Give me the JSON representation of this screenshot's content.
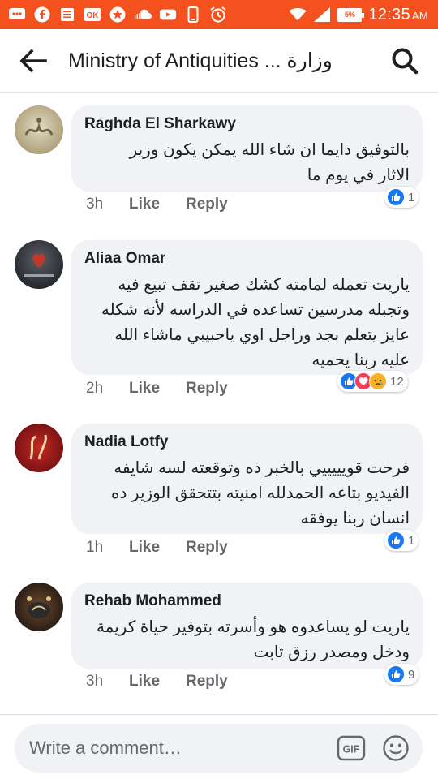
{
  "status_bar": {
    "time": "12:35",
    "ampm": "AM",
    "battery": "5%",
    "colors": {
      "background": "#f4511e"
    },
    "icons": [
      "messages-icon",
      "facebook-icon",
      "news-icon",
      "vk-icon",
      "star-icon",
      "soundcloud-icon",
      "youtube-icon",
      "phone-icon",
      "alarm-icon",
      "wifi-icon",
      "signal-icon",
      "battery-icon"
    ]
  },
  "header": {
    "title": "Ministry of Antiquities ... وزارة"
  },
  "comments": [
    {
      "author": "Raghda El Sharkawy",
      "text": "بالتوفيق دايما ان شاء الله يمكن يكون وزير الاثار في يوم ما",
      "time": "3h",
      "like": "Like",
      "reply": "Reply",
      "reactions": [
        "like"
      ],
      "reaction_count": "1"
    },
    {
      "author": "Aliaa Omar",
      "text": "ياريت تعمله لمامته كشك صغير تقف تبيع فيه وتجبله مدرسين تساعده في الدراسه لأنه شكله عايز يتعلم بجد وراجل اوي ياحبيبي ماشاء الله عليه ربنا يحميه",
      "time": "2h",
      "like": "Like",
      "reply": "Reply",
      "reactions": [
        "like",
        "love",
        "sad"
      ],
      "reaction_count": "12"
    },
    {
      "author": "Nadia Lotfy",
      "text": "فرحت قويييييي بالخبر ده وتوقعته لسه شايفه الفيديو بتاعه الحمدلله امنيته بتتحقق الوزير ده انسان ربنا يوفقه",
      "time": "1h",
      "like": "Like",
      "reply": "Reply",
      "reactions": [
        "like"
      ],
      "reaction_count": "1"
    },
    {
      "author": "Rehab Mohammed",
      "text": "ياريت لو يساعدوه هو وأسرته بتوفير حياة كريمة ودخل ومصدر رزق ثابت",
      "time": "3h",
      "like": "Like",
      "reply": "Reply",
      "reactions": [
        "like"
      ],
      "reaction_count": "9"
    }
  ],
  "composer": {
    "placeholder": "Write a comment…",
    "gif_label": "GIF"
  }
}
